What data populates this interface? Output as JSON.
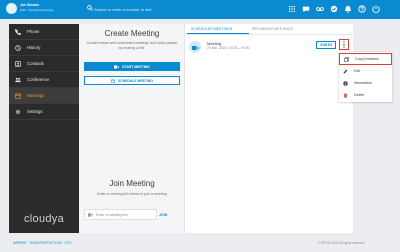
{
  "header": {
    "user_name": "Joe Kimano",
    "user_status": "(604 - Desktop phone(s))",
    "search_placeholder": "Search or enter a number to dial"
  },
  "sidebar": {
    "items": [
      {
        "label": "Phone",
        "icon": "phone-icon"
      },
      {
        "label": "History",
        "icon": "history-icon"
      },
      {
        "label": "Contacts",
        "icon": "contacts-icon"
      },
      {
        "label": "Conference",
        "icon": "conference-icon"
      },
      {
        "label": "Meetings",
        "icon": "meetings-icon",
        "active": true
      },
      {
        "label": "Settings",
        "icon": "gear-icon"
      }
    ],
    "logo": "cloudya"
  },
  "create": {
    "title": "Create Meeting",
    "description": "Create instant and scheduled meetings and invite people by sharing a link.",
    "start_label": "START MEETING",
    "schedule_label": "SCHEDULE MEETING"
  },
  "join": {
    "title": "Join Meeting",
    "description": "Enter a meeting link below to join a meeting",
    "placeholder": "Enter a meeting link",
    "button_label": "JOIN"
  },
  "meetings": {
    "tabs": [
      "SCHEDULED MEETINGS",
      "RECURRING MEETINGS"
    ],
    "item": {
      "title": "Meeting",
      "time": "29 Mar, 2022 • 09:30 – 09:50",
      "join_label": "JOIN ES"
    }
  },
  "context_menu": {
    "items": [
      "Copy Invitation",
      "Edit",
      "Information",
      "Delete"
    ]
  },
  "footer": {
    "links": "IMPRINT · DATA PROTECTION · GTC",
    "copyright": "© NFON 2022 All rights reserved"
  },
  "colors": {
    "primary": "#0a8ad0",
    "accent": "#f1962c",
    "highlight": "#d6403a",
    "sidebar": "#2b2b2b"
  }
}
